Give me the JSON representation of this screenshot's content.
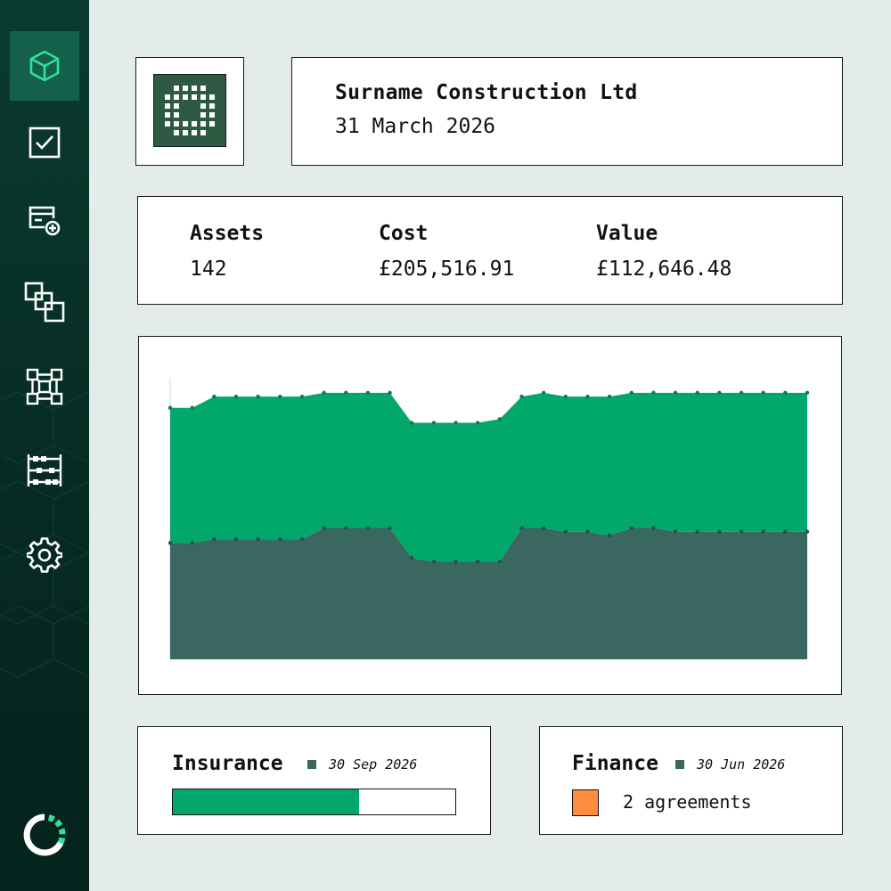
{
  "sidebar": {
    "items": [
      {
        "name": "cube-icon",
        "active": true
      },
      {
        "name": "checkbox-icon",
        "active": false
      },
      {
        "name": "add-card-icon",
        "active": false
      },
      {
        "name": "copy-squares-icon",
        "active": false
      },
      {
        "name": "network-icon",
        "active": false
      },
      {
        "name": "abacus-icon",
        "active": false
      },
      {
        "name": "gear-icon",
        "active": false
      }
    ],
    "brand_icon": "ring-logo-icon"
  },
  "company": {
    "name": "Surname Construction Ltd",
    "date": "31 March 2026",
    "logo_icon": "company-logo-icon"
  },
  "stats": {
    "assets_label": "Assets",
    "assets_value": "142",
    "cost_label": "Cost",
    "cost_value": "£205,516.91",
    "value_label": "Value",
    "value_value": "£112,646.48"
  },
  "chart_data": {
    "type": "area",
    "stacked": true,
    "grid": false,
    "x_count": 30,
    "series": [
      {
        "values": [
          31,
          31,
          32,
          32,
          32,
          32,
          32,
          35,
          35,
          35,
          35,
          27,
          26,
          26,
          26,
          26,
          35,
          35,
          34,
          34,
          33,
          35,
          35,
          34,
          34,
          34,
          34,
          34,
          34,
          34
        ],
        "color": "#3a6860"
      },
      {
        "values": [
          36,
          36,
          38,
          38,
          38,
          38,
          38,
          36,
          36,
          36,
          36,
          36,
          37,
          37,
          37,
          38,
          35,
          36,
          36,
          36,
          37,
          36,
          36,
          37,
          37,
          37,
          37,
          37,
          37,
          37
        ],
        "color": "#02a86b"
      }
    ],
    "ylim": [
      0,
      75
    ]
  },
  "insurance": {
    "title": "Insurance",
    "date": "30 Sep 2026",
    "progress": 0.66,
    "fill_color": "#02a86b"
  },
  "finance": {
    "title": "Finance",
    "date": "30 Jun 2026",
    "agreements_text": "2 agreements",
    "swatch_color": "#fd8e40"
  }
}
